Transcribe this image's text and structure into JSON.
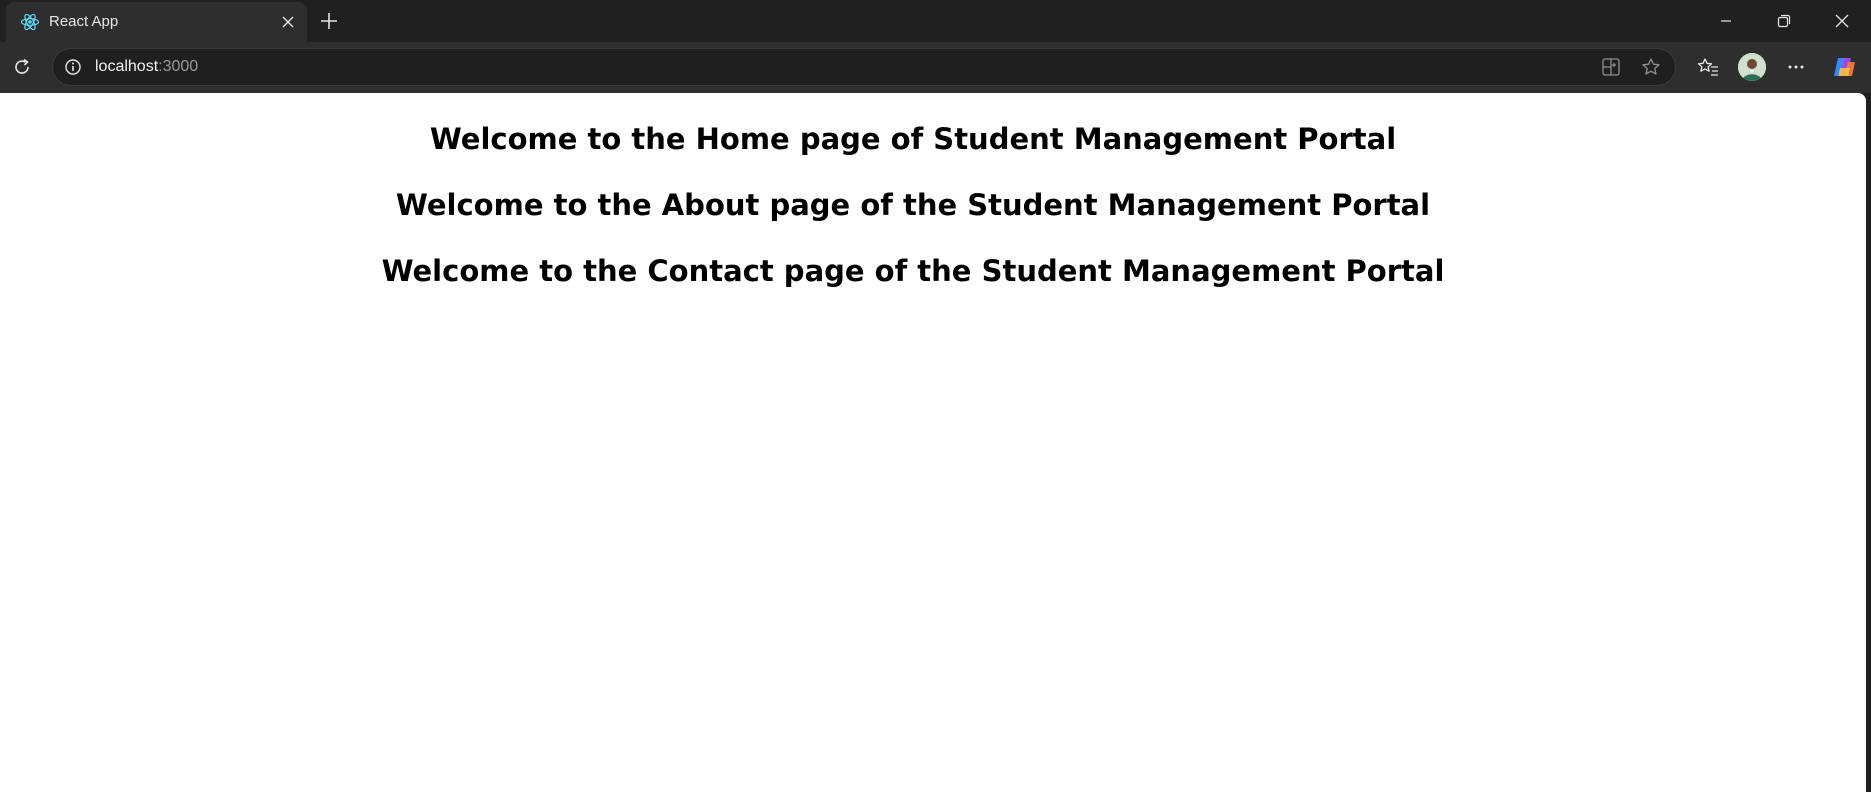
{
  "browser": {
    "tab": {
      "title": "React App",
      "favicon_icon": "react-logo-icon"
    },
    "address_bar": {
      "host": "localhost",
      "port": ":3000"
    },
    "colors": {
      "chrome_dark": "#202020",
      "toolbar": "#2e2e2e",
      "omnibox": "#1f1f1f",
      "react_accent": "#61dafb"
    }
  },
  "page": {
    "headings": {
      "home": "Welcome to the Home page of Student Management Portal",
      "about": "Welcome to the About page of the Student Management Portal",
      "contact": "Welcome to the Contact page of the Student Management Portal"
    }
  }
}
